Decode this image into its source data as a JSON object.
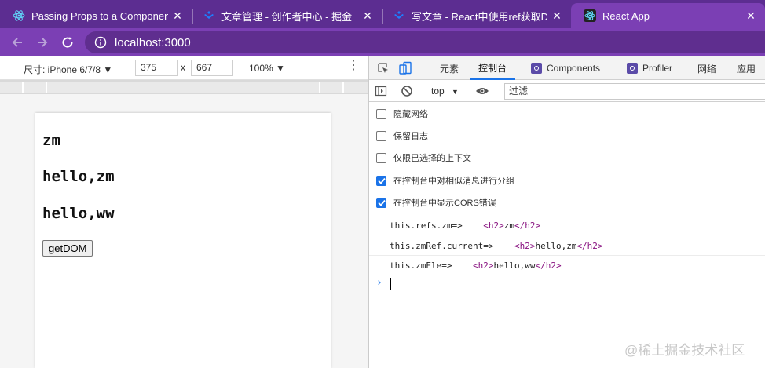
{
  "browser": {
    "tabs": [
      {
        "title": "Passing Props to a Component",
        "active": false
      },
      {
        "title": "文章管理 - 创作者中心 - 掘金",
        "active": false
      },
      {
        "title": "写文章 - React中使用ref获取DO",
        "active": false
      },
      {
        "title": "React App",
        "active": true
      }
    ],
    "close_glyph": "✕",
    "url": "localhost:3000"
  },
  "device_toolbar": {
    "dimensions_label": "尺寸: iPhone 6/7/8",
    "width": "375",
    "times": "x",
    "height": "667",
    "zoom": "100%"
  },
  "page": {
    "headings": [
      "zm",
      "hello,zm",
      "hello,ww"
    ],
    "button_label": "getDOM"
  },
  "devtools": {
    "tabs": [
      "元素",
      "控制台",
      "Components",
      "Profiler",
      "网络",
      "应用"
    ],
    "active_tab": "控制台",
    "context": "top",
    "filter_placeholder": "过滤",
    "settings": [
      {
        "label": "隐藏网络",
        "checked": false
      },
      {
        "label": "保留日志",
        "checked": false
      },
      {
        "label": "仅限已选择的上下文",
        "checked": false
      },
      {
        "label": "在控制台中对相似消息进行分组",
        "checked": true
      },
      {
        "label": "在控制台中显示CORS错误",
        "checked": true
      }
    ],
    "logs": [
      {
        "prefix": "this.refs.zm=>",
        "open_tag": "<h2>",
        "content": "zm",
        "close_tag": "</h2>"
      },
      {
        "prefix": "this.zmRef.current=>",
        "open_tag": "<h2>",
        "content": "hello,zm",
        "close_tag": "</h2>"
      },
      {
        "prefix": "this.zmEle=>",
        "open_tag": "<h2>",
        "content": "hello,ww",
        "close_tag": "</h2>"
      }
    ],
    "prompt_glyph": "›"
  },
  "watermark": "@稀土掘金技术社区",
  "colors": {
    "tabstrip": "#5c2d91",
    "toolbar": "#7b3fb4",
    "accent": "#1a73e8",
    "tag": "#881280"
  }
}
